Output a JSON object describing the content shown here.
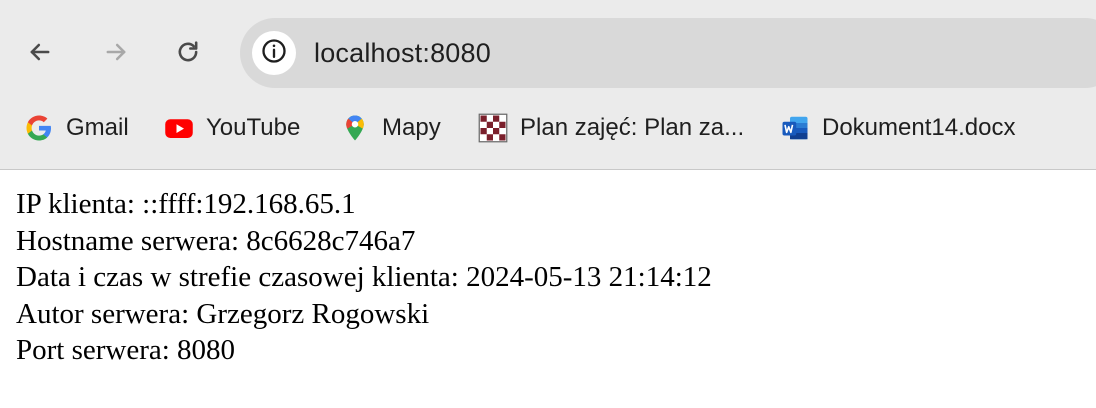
{
  "browser": {
    "url": "localhost:8080",
    "nav": {
      "back_icon": "back-arrow-icon",
      "forward_icon": "forward-arrow-icon",
      "reload_icon": "reload-icon",
      "site_info_icon": "info-icon"
    },
    "bookmarks": [
      {
        "label": "Gmail",
        "icon": "google-g-icon"
      },
      {
        "label": "YouTube",
        "icon": "youtube-icon"
      },
      {
        "label": "Mapy",
        "icon": "maps-pin-icon"
      },
      {
        "label": "Plan zajęć: Plan za...",
        "icon": "checkerboard-icon"
      },
      {
        "label": "Dokument14.docx",
        "icon": "word-doc-icon"
      }
    ]
  },
  "page": {
    "lines": [
      "IP klienta: ::ffff:192.168.65.1",
      "Hostname serwera: 8c6628c746a7",
      "Data i czas w strefie czasowej klienta: 2024-05-13 21:14:12",
      "Autor serwera: Grzegorz Rogowski",
      "Port serwera: 8080"
    ]
  },
  "colors": {
    "chrome_background": "#ebebeb",
    "omnibox_background": "#d9d9d9",
    "page_background": "#ffffff",
    "text": "#1f1f1f"
  }
}
